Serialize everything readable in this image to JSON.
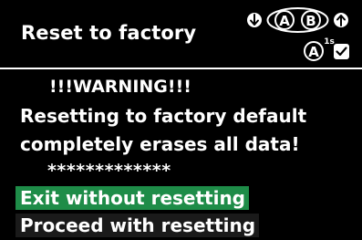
{
  "header": {
    "title": "Reset to factory",
    "hints": {
      "down_icon": "arrow-down-icon",
      "up_icon": "arrow-up-icon",
      "button_a": "A",
      "button_b": "B",
      "hold_a": "A",
      "hold_duration": "1s",
      "confirm_icon": "checkmark-icon"
    }
  },
  "warning": {
    "title": "!!!WARNING!!!",
    "line1": "Resetting to factory default",
    "line2": "completely erases all data!",
    "stars": "*************"
  },
  "options": [
    {
      "label": "Exit without resetting",
      "selected": true
    },
    {
      "label": "Proceed with resetting",
      "selected": false
    }
  ],
  "colors": {
    "background": "#000000",
    "text": "#ffffff",
    "selected_highlight": "#1e8c48",
    "option_background": "#1a1a1a"
  }
}
